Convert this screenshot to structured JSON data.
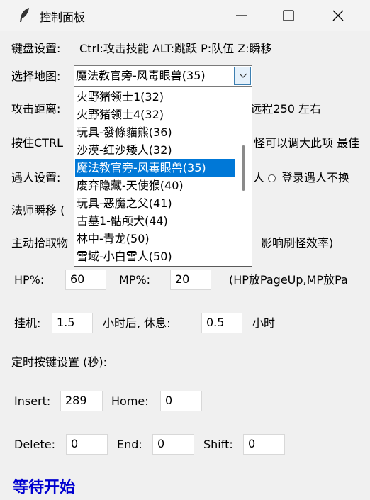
{
  "window": {
    "title": "控制面板"
  },
  "keyboard": {
    "label": "键盘设置:",
    "value": "Ctrl:攻击技能 ALT:跳跃 P:队伍 Z:瞬移"
  },
  "map": {
    "label": "选择地图:",
    "selected": "魔法教官旁-风毒眼兽(35)",
    "options": [
      "火野猪领士1(32)",
      "火野猪领士4(32)",
      "玩具-發條貓熊(36)",
      "沙漠-红沙矮人(32)",
      "魔法教官旁-风毒眼兽(35)",
      "废弃隐藏-天使猴(40)",
      "玩具-恶魔之父(41)",
      "古墓1-骷颅犬(44)",
      "林中-青龙(50)",
      "雪域-小白雪人(50)"
    ],
    "selected_index": 4
  },
  "attack": {
    "label": "攻击距离:",
    "suffix": ") 远程250 左右"
  },
  "hold_ctrl": {
    "label": "按住CTRL",
    "suffix": "怪可以调大此项 最佳"
  },
  "encounter": {
    "label": "遇人设置:",
    "option_partial": "人",
    "option_2": "登录遇人不换"
  },
  "mage": {
    "label": "法师瞬移 ("
  },
  "pickup": {
    "label": "主动拾取物",
    "suffix": "影响刷怪效率)"
  },
  "hpmp": {
    "hp_label": "HP%:",
    "hp_value": "60",
    "mp_label": "MP%:",
    "mp_value": "20",
    "note": "(HP放PageUp,MP放Pa"
  },
  "hangup": {
    "label": "挂机:",
    "value": "1.5",
    "after_label": "小时后, 休息:",
    "rest_value": "0.5",
    "unit": "小时"
  },
  "timer": {
    "label": "定时按键设置 (秒):",
    "insert_label": "Insert:",
    "insert_value": "289",
    "home_label": "Home:",
    "home_value": "0",
    "delete_label": "Delete:",
    "delete_value": "0",
    "end_label": "End:",
    "end_value": "0",
    "shift_label": "Shift:",
    "shift_value": "0"
  },
  "status": {
    "text": "等待开始"
  },
  "colors": {
    "highlight": "#0078d7",
    "status_text": "#0000d0",
    "background": "#f0f0f0"
  }
}
